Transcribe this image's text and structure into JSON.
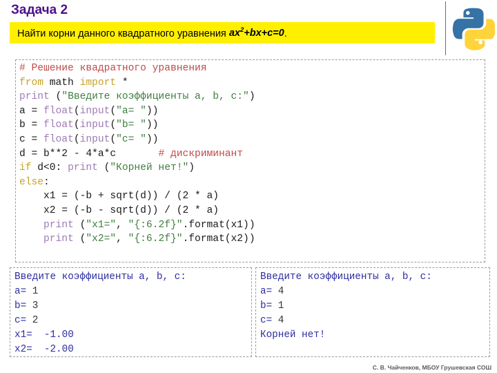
{
  "slide": {
    "title": "Задача 2",
    "banner": {
      "text_before": "Найти корни данного квадратного уравнения ",
      "equation_base1": "ax",
      "equation_sup": "2",
      "equation_base2": "+bx+c=0",
      "text_after": ".",
      "background_color": "#FFF000"
    },
    "logo": {
      "name": "python-logo",
      "blue": "#3572A5",
      "yellow": "#FFD43B"
    },
    "footer": "С. В. Чайченков, МБОУ Грушевская СОШ"
  },
  "code_block": {
    "language": "python",
    "colors": {
      "keyword": "#C9A227",
      "function": "#9E7BB5",
      "string": "#3F7F3F",
      "comment": "#C04A4A",
      "default": "#1a1a1a"
    },
    "lines": [
      [
        {
          "t": "# Решение квадратного уравнения",
          "c": "com"
        }
      ],
      [
        {
          "t": "from",
          "c": "kw"
        },
        {
          "t": " math ",
          "c": "op"
        },
        {
          "t": "import",
          "c": "kw"
        },
        {
          "t": " *",
          "c": "op"
        }
      ],
      [
        {
          "t": "print",
          "c": "fn"
        },
        {
          "t": " (",
          "c": "op"
        },
        {
          "t": "\"Введите коэффициенты a, b, c:\"",
          "c": "str"
        },
        {
          "t": ")",
          "c": "op"
        }
      ],
      [
        {
          "t": "a = ",
          "c": "op"
        },
        {
          "t": "float",
          "c": "fn"
        },
        {
          "t": "(",
          "c": "op"
        },
        {
          "t": "input",
          "c": "fn"
        },
        {
          "t": "(",
          "c": "op"
        },
        {
          "t": "\"a= \"",
          "c": "str"
        },
        {
          "t": "))",
          "c": "op"
        }
      ],
      [
        {
          "t": "b = ",
          "c": "op"
        },
        {
          "t": "float",
          "c": "fn"
        },
        {
          "t": "(",
          "c": "op"
        },
        {
          "t": "input",
          "c": "fn"
        },
        {
          "t": "(",
          "c": "op"
        },
        {
          "t": "\"b= \"",
          "c": "str"
        },
        {
          "t": "))",
          "c": "op"
        }
      ],
      [
        {
          "t": "c = ",
          "c": "op"
        },
        {
          "t": "float",
          "c": "fn"
        },
        {
          "t": "(",
          "c": "op"
        },
        {
          "t": "input",
          "c": "fn"
        },
        {
          "t": "(",
          "c": "op"
        },
        {
          "t": "\"c= \"",
          "c": "str"
        },
        {
          "t": "))",
          "c": "op"
        }
      ],
      [
        {
          "t": "d = b**2 - 4*a*c       ",
          "c": "op"
        },
        {
          "t": "# дискриминант",
          "c": "com"
        }
      ],
      [
        {
          "t": "if",
          "c": "kw"
        },
        {
          "t": " d<0: ",
          "c": "op"
        },
        {
          "t": "print",
          "c": "fn"
        },
        {
          "t": " (",
          "c": "op"
        },
        {
          "t": "\"Корней нет!\"",
          "c": "str"
        },
        {
          "t": ")",
          "c": "op"
        }
      ],
      [
        {
          "t": "else",
          "c": "kw"
        },
        {
          "t": ":",
          "c": "op"
        }
      ],
      [
        {
          "t": "    x1 = (-b + sqrt(d)) / (2 * a)",
          "c": "op"
        }
      ],
      [
        {
          "t": "    x2 = (-b - sqrt(d)) / (2 * a)",
          "c": "op"
        }
      ],
      [
        {
          "t": "    ",
          "c": "op"
        },
        {
          "t": "print",
          "c": "fn"
        },
        {
          "t": " (",
          "c": "op"
        },
        {
          "t": "\"x1=\"",
          "c": "str"
        },
        {
          "t": ", ",
          "c": "op"
        },
        {
          "t": "\"{:6.2f}\"",
          "c": "str"
        },
        {
          "t": ".format(x1))",
          "c": "op"
        }
      ],
      [
        {
          "t": "    ",
          "c": "op"
        },
        {
          "t": "print",
          "c": "fn"
        },
        {
          "t": " (",
          "c": "op"
        },
        {
          "t": "\"x2=\"",
          "c": "str"
        },
        {
          "t": ", ",
          "c": "op"
        },
        {
          "t": "\"{:6.2f}\"",
          "c": "str"
        },
        {
          "t": ".format(x2))",
          "c": "op"
        }
      ]
    ]
  },
  "output_left": {
    "lines": [
      [
        {
          "t": "Введите коэффициенты a, b, c:",
          "c": ""
        }
      ],
      [
        {
          "t": "a= ",
          "c": ""
        },
        {
          "t": "1",
          "c": "val"
        }
      ],
      [
        {
          "t": "b= ",
          "c": ""
        },
        {
          "t": "3",
          "c": "val"
        }
      ],
      [
        {
          "t": "c= ",
          "c": ""
        },
        {
          "t": "2",
          "c": "val"
        }
      ],
      [
        {
          "t": "x1=  -1.00",
          "c": ""
        }
      ],
      [
        {
          "t": "x2=  -2.00",
          "c": ""
        }
      ]
    ]
  },
  "output_right": {
    "lines": [
      [
        {
          "t": "Введите коэффициенты a, b, c:",
          "c": ""
        }
      ],
      [
        {
          "t": "a= ",
          "c": ""
        },
        {
          "t": "4",
          "c": "val"
        }
      ],
      [
        {
          "t": "b= ",
          "c": ""
        },
        {
          "t": "1",
          "c": "val"
        }
      ],
      [
        {
          "t": "c= ",
          "c": ""
        },
        {
          "t": "4",
          "c": "val"
        }
      ],
      [
        {
          "t": "Корней нет!",
          "c": ""
        }
      ]
    ]
  }
}
